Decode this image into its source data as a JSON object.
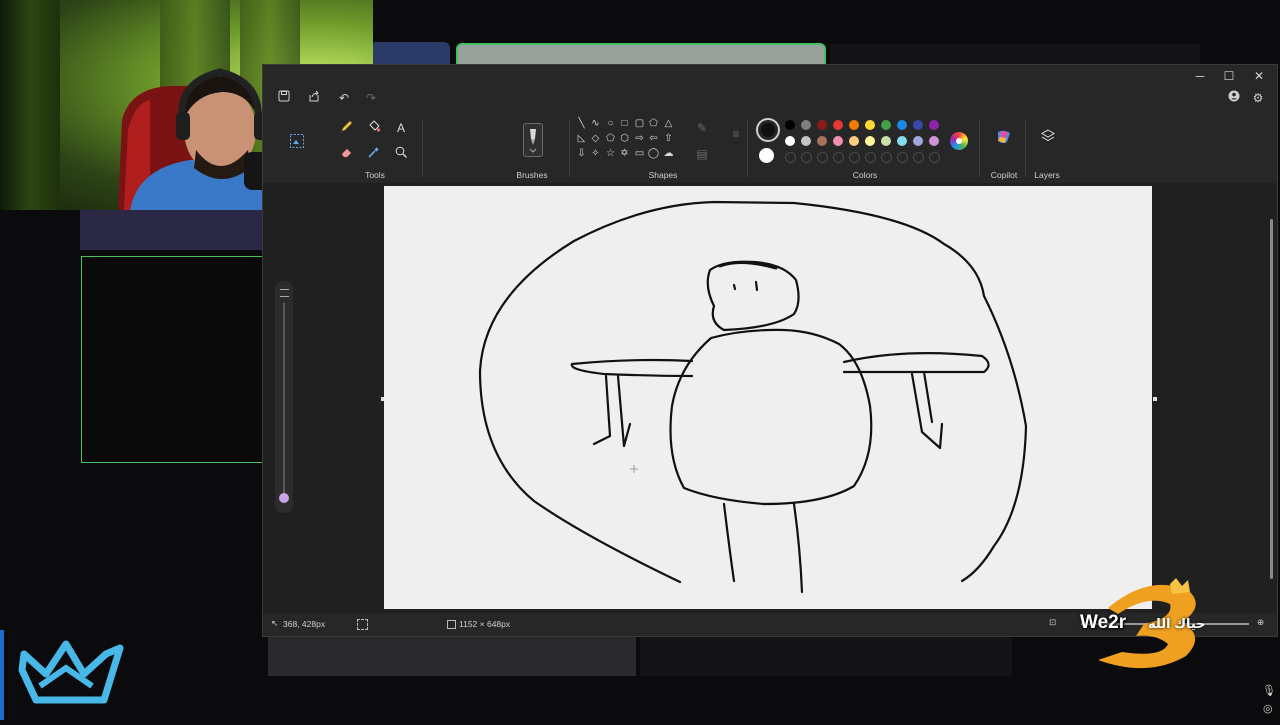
{
  "paint": {
    "ribbon": {
      "groups": {
        "tools": "Tools",
        "brushes": "Brushes",
        "shapes": "Shapes",
        "colors": "Colors",
        "copilot": "Copilot",
        "layers": "Layers"
      },
      "text_tool_glyph": "A",
      "primary_color": "#111111",
      "secondary_color": "#ffffff",
      "palette_row1": [
        "#000000",
        "#7f7f7f",
        "#8b1a1a",
        "#e53935",
        "#f57c00",
        "#fdd835",
        "#43a047",
        "#1e88e5",
        "#3949ab",
        "#8e24aa"
      ],
      "palette_row2": [
        "#ffffff",
        "#c3c3c3",
        "#a8735a",
        "#f48fb1",
        "#ffcc80",
        "#fff59d",
        "#c5e1a5",
        "#80deea",
        "#9fa8da",
        "#ce93d8"
      ]
    },
    "status": {
      "cursor_position": "368, 428px",
      "canvas_size": "1152 × 648px"
    }
  },
  "overlay": {
    "we2r_text": "We2r",
    "arabic_greeting": "حياك الله"
  },
  "colors": {
    "accent_green": "#47c15a",
    "window_bg": "#272727",
    "canvas_bg": "#efefef"
  }
}
